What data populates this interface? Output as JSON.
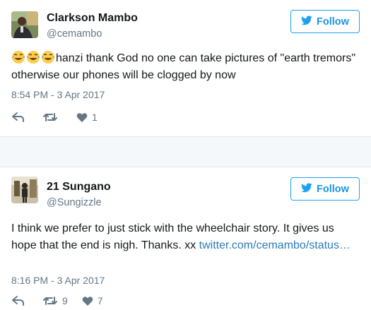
{
  "tweets": [
    {
      "name": "Clarkson Mambo",
      "handle": "@cemambo",
      "follow_label": "Follow",
      "emoji_prefix": [
        "tears-of-joy",
        "tears-of-joy",
        "tears-of-joy"
      ],
      "text": "hanzi thank God no one can take pictures of \"earth tremors\" otherwise our phones will be clogged by now",
      "time": "8:54 PM - 3 Apr 2017",
      "retweets": "",
      "likes": "1"
    },
    {
      "name": "21 Sungano",
      "handle": "@Sungizzle",
      "follow_label": "Follow",
      "text": "I think we prefer to just stick with the wheelchair story. It gives us hope that the end is nigh. Thanks. xx ",
      "link_text": "twitter.com/cemambo/status…",
      "time": "8:16 PM - 3 Apr 2017",
      "retweets": "9",
      "likes": "7"
    }
  ],
  "colors": {
    "accent": "#1da1f2",
    "link": "#2b7bb9",
    "muted": "#657786",
    "text": "#14171a",
    "separator": "#f5f8fa"
  },
  "icons": [
    "bird-icon",
    "reply-icon",
    "retweet-icon",
    "heart-icon",
    "tears-of-joy-emoji"
  ]
}
